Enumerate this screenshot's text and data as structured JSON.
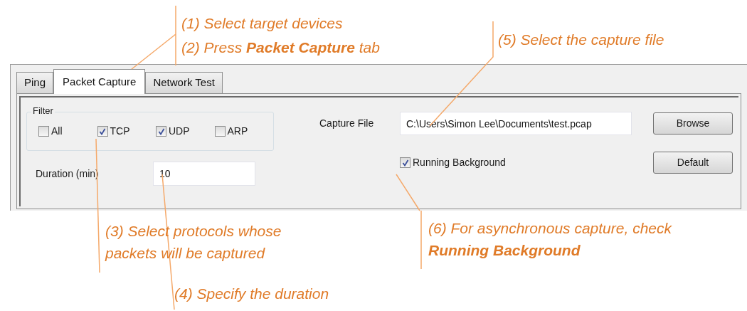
{
  "tabs": [
    {
      "label": "Ping",
      "selected": false
    },
    {
      "label": "Packet Capture",
      "selected": true
    },
    {
      "label": "Network Test",
      "selected": false
    }
  ],
  "filter": {
    "title": "Filter",
    "options": [
      {
        "label": "All",
        "checked": false
      },
      {
        "label": "TCP",
        "checked": true
      },
      {
        "label": "UDP",
        "checked": true
      },
      {
        "label": "ARP",
        "checked": false
      }
    ]
  },
  "duration": {
    "label": "Duration (min)",
    "value": "10"
  },
  "capture_file": {
    "label": "Capture File",
    "value": "C:\\Users\\Simon Lee\\Documents\\test.pcap"
  },
  "running_background": {
    "label": "Running Background",
    "checked": true
  },
  "buttons": [
    "Browse",
    "Default"
  ],
  "annotations": [
    "(1) Select target devices",
    "(2) Press **Packet Capture** tab",
    "(5) Select the capture file",
    "(3) Select protocols whose packets will be captured",
    "(4) Specify the duration",
    "(6) For asynchronous capture, check **Running Background**"
  ]
}
